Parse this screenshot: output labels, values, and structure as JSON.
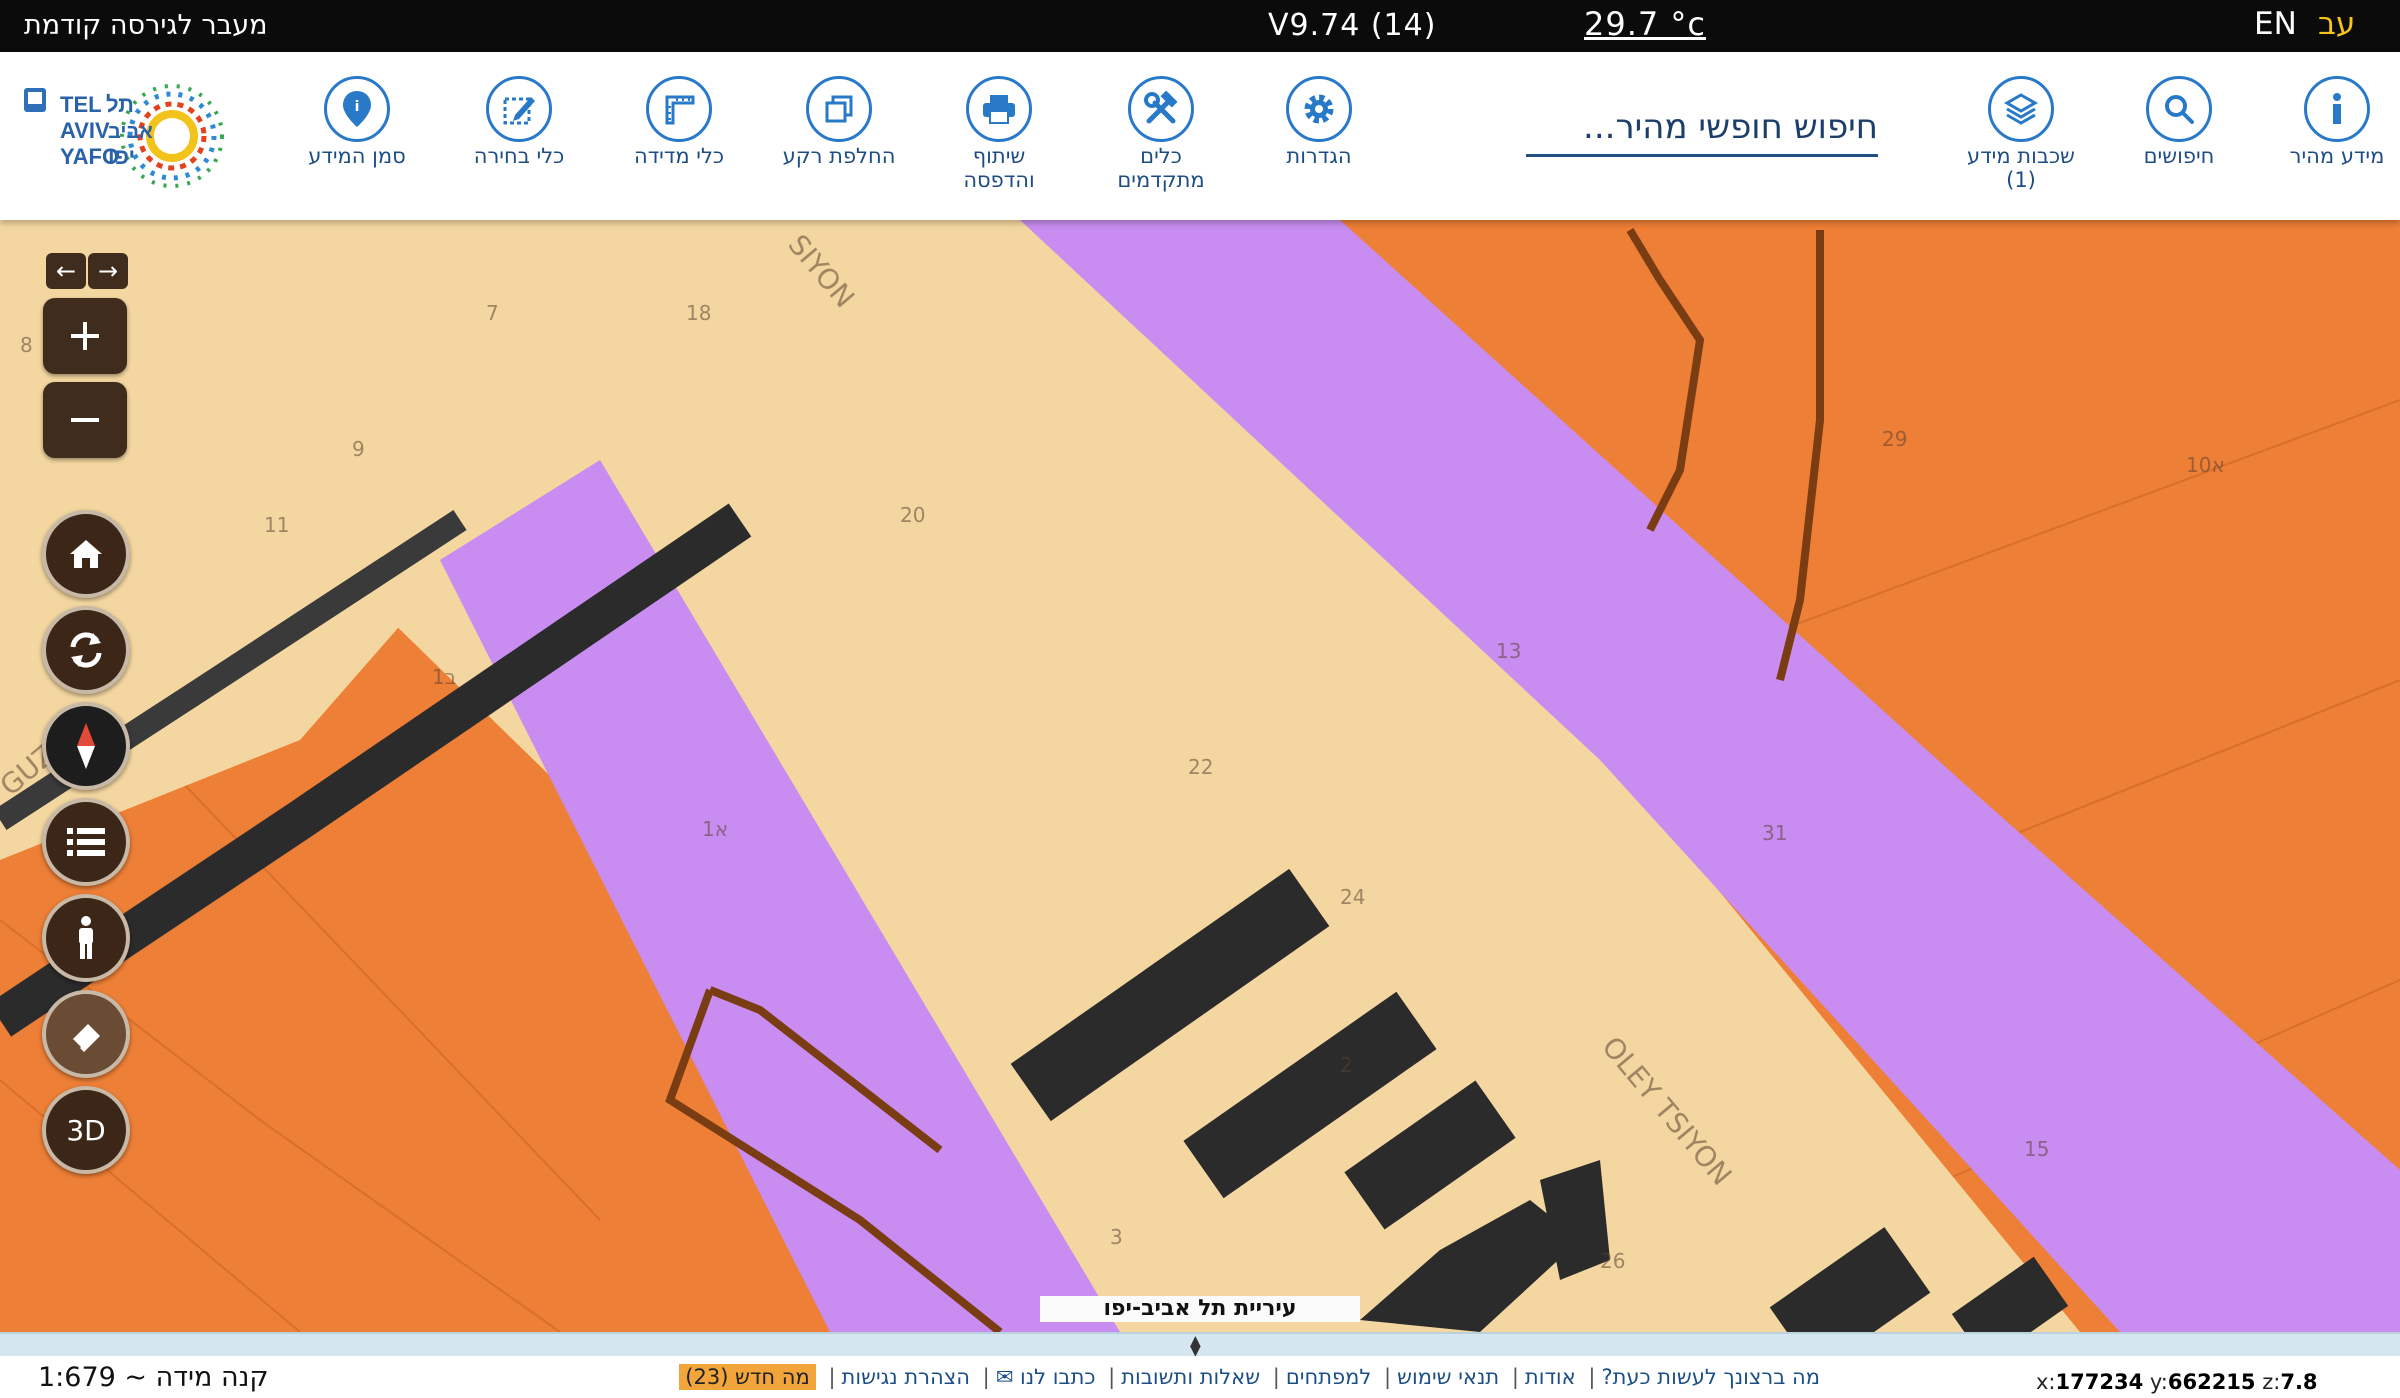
{
  "topbar": {
    "prev_version_link": "מעבר לגירסה קודמת",
    "version": "V9.74 (14)",
    "temperature": "29.7 °c",
    "lang_en": "EN",
    "lang_he": "עב"
  },
  "logo": {
    "text_latin_1": "TEL",
    "text_latin_2": "AVIV",
    "text_latin_3": "YAFO",
    "text_he_1": "תל",
    "text_he_2": "אביב",
    "text_he_3": "יפו"
  },
  "toolbar": {
    "info_marker": "סמן המידע",
    "selection_tools": "כלי בחירה",
    "measure_tools": "כלי מדידה",
    "basemap_switch": "החלפת רקע",
    "share_print_1": "שיתוף",
    "share_print_2": "והדפסה",
    "advanced_tools_1": "כלים",
    "advanced_tools_2": "מתקדמים",
    "settings": "הגדרות",
    "search_placeholder": "חיפוש חופשי מהיר...",
    "layers_1": "שכבות מידע",
    "layers_2": "(1)",
    "searches": "חיפושים",
    "quick_info": "מידע מהיר"
  },
  "map_labels": {
    "street_1": "SIYON",
    "street_2": "GUZA",
    "street_3": "OLEY TSIYON",
    "n1": "7",
    "n2": "8",
    "n3": "9",
    "n4": "11",
    "n5": "18",
    "n6": "20",
    "n7": "13",
    "n8": "29",
    "n9": "10א",
    "n10": "22",
    "n11": "24",
    "n12": "31",
    "n13": "1א",
    "n14": "1ב",
    "n15": "2",
    "n16": "3",
    "n17": "26",
    "n18": "15"
  },
  "map_controls": {
    "btn_3d": "3D"
  },
  "attribution": "עיריית תל אביב-יפו",
  "footer": {
    "scale_label": "קנה מידה ~ 1:679",
    "links": [
      "מה ברצונך לעשות כעת?",
      "אודות",
      "תנאי שימוש",
      "למפתחים",
      "שאלות ותשובות",
      "כתבו לנו ✉",
      "הצהרת נגישות"
    ],
    "whats_new": "מה חדש (23)",
    "coord_x_label": "x:",
    "coord_x": "177234",
    "coord_y_label": "y:",
    "coord_y": "662215",
    "coord_z_label": "z:",
    "coord_z": "7.8"
  },
  "colors": {
    "residential_orange": "#ee7f36",
    "road_purple": "#c98cf0",
    "sidewalk_beige": "#f4d7a0",
    "building_dark": "#2b2b2b",
    "accent_blue": "#2979c9"
  }
}
